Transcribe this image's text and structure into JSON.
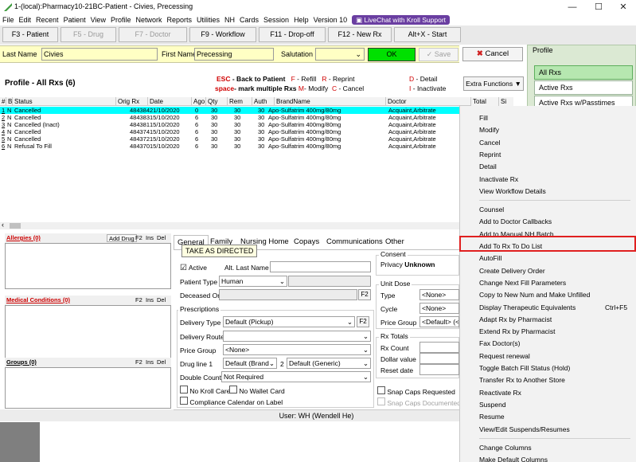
{
  "window": {
    "title": "1-(local):Pharmacy10-21BC-Patient - Civies, Precessing",
    "min": "—",
    "max": "☐",
    "close": "✕"
  },
  "menu": [
    "File",
    "Edit",
    "Recent",
    "Patient",
    "View",
    "Profile",
    "Network",
    "Reports",
    "Utilities",
    "NH",
    "Cards",
    "Session",
    "Help",
    "Version 10"
  ],
  "livechat": "LiveChat with Kroll Support",
  "toolbar": [
    {
      "label": "F3 - Patient",
      "enabled": true
    },
    {
      "label": "F5 - Drug",
      "enabled": false
    },
    {
      "label": "F7 - Doctor",
      "enabled": false
    },
    {
      "label": "F9 - Workflow",
      "enabled": true
    },
    {
      "label": "F11 - Drop-off",
      "enabled": true
    },
    {
      "label": "F12 - New Rx",
      "enabled": true
    },
    {
      "label": "Alt+X - Start",
      "enabled": true
    }
  ],
  "patient": {
    "last_name_label": "Last Name",
    "last_name": "Civies",
    "first_name_label": "First Name",
    "first_name": "Precessing",
    "salutation_label": "Salutation",
    "salutation": "",
    "ok": "OK",
    "save": "Save",
    "cancel": "Cancel"
  },
  "profile_panel": {
    "title": "Profile",
    "items": [
      "All Rxs",
      "Active Rxs",
      "Active Rxs w/Passtimes"
    ]
  },
  "profile": {
    "title": "Profile - All Rxs (6)",
    "esc_key": "ESC",
    "esc_text": "- Back to Patient",
    "f_key": "F",
    "f_text": "- Refill",
    "r_key": "R",
    "r_text": "- Reprint",
    "d_key": "D",
    "d_text": "- Detail",
    "space_key": "space",
    "space_text": "- mark multiple Rxs",
    "m_key": "M",
    "m_text": "- Modify",
    "c_key": "C",
    "c_text": "- Cancel",
    "i_key": "I",
    "i_text": "- Inactivate",
    "extra_functions": "Extra Functions ▼"
  },
  "grid": {
    "columns": [
      "#",
      "B",
      "Status",
      "Orig Rx",
      "Date",
      "Ago",
      "Qty",
      "Rem",
      "Auth",
      "BrandName",
      "Doctor",
      "Total",
      "Si"
    ],
    "rows": [
      {
        "n": "1",
        "b": "N",
        "status": "Cancelled",
        "orig": "484384",
        "date": "21/10/2020",
        "ago": "0",
        "qty": "30",
        "rem": "30",
        "auth": "30",
        "brand": "Apo-Sulfatrim 400mg/80mg",
        "doctor": "Acquaint,Arbitrate"
      },
      {
        "n": "2",
        "b": "N",
        "status": "Cancelled",
        "orig": "484383",
        "date": "15/10/2020",
        "ago": "6",
        "qty": "30",
        "rem": "30",
        "auth": "30",
        "brand": "Apo-Sulfatrim 400mg/80mg",
        "doctor": "Acquaint,Arbitrate"
      },
      {
        "n": "3",
        "b": "N",
        "status": "Cancelled (Inact)",
        "orig": "484381",
        "date": "15/10/2020",
        "ago": "6",
        "qty": "30",
        "rem": "30",
        "auth": "30",
        "brand": "Apo-Sulfatrim 400mg/80mg",
        "doctor": "Acquaint,Arbitrate"
      },
      {
        "n": "4",
        "b": "N",
        "status": "Cancelled",
        "orig": "484374",
        "date": "15/10/2020",
        "ago": "6",
        "qty": "30",
        "rem": "30",
        "auth": "30",
        "brand": "Apo-Sulfatrim 400mg/80mg",
        "doctor": "Acquaint,Arbitrate"
      },
      {
        "n": "5",
        "b": "N",
        "status": "Cancelled",
        "orig": "484372",
        "date": "15/10/2020",
        "ago": "6",
        "qty": "30",
        "rem": "30",
        "auth": "30",
        "brand": "Apo-Sulfatrim 400mg/80mg",
        "doctor": "Acquaint,Arbitrate"
      },
      {
        "n": "6",
        "b": "N",
        "status": "Refusal To Fill",
        "orig": "484370",
        "date": "15/10/2020",
        "ago": "6",
        "qty": "30",
        "rem": "30",
        "auth": "30",
        "brand": "Apo-Sulfatrim 400mg/80mg",
        "doctor": "Acquaint,Arbitrate"
      }
    ]
  },
  "left_panels": {
    "allergies": "Allergies (0)",
    "add_drug": "Add Drug",
    "f2": "F2",
    "ins": "Ins",
    "del": "Del",
    "medical": "Medical Conditions (0)",
    "groups": "Groups (0)"
  },
  "tabs": [
    "General",
    "Family",
    "Nursing Home",
    "Copays",
    "Communications",
    "Other"
  ],
  "tooltip": "TAKE AS DIRECTED",
  "general": {
    "active": "Active",
    "alt_last_name": "Alt. Last Name",
    "patient_type_label": "Patient Type",
    "patient_type": "Human",
    "deceased_on": "Deceased On",
    "f2": "F2",
    "prescriptions": "Prescriptions",
    "delivery_type_label": "Delivery Type",
    "delivery_type": "Default (Pickup)",
    "delivery_route_label": "Delivery Route",
    "price_group_label": "Price Group",
    "price_group": "<None>",
    "drug_line_label": "Drug line 1",
    "drug_line_1": "Default (Brand",
    "drug_line_2_label": "2",
    "drug_line_2": "Default (Generic)",
    "double_count_label": "Double Count",
    "double_count": "Not Required",
    "no_kroll_care": "No Kroll Care",
    "no_wallet_card": "No Wallet Card",
    "compliance_calendar": "Compliance Calendar on Label",
    "consent": "Consent",
    "privacy": "Privacy",
    "privacy_value": "Unknown",
    "unit_dose": "Unit Dose",
    "type_label": "Type",
    "type_value": "<None>",
    "cycle_label": "Cycle",
    "cycle_value": "<None>",
    "price_group2_label": "Price Group",
    "price_group2_value": "<Default> (<I",
    "rx_totals": "Rx Totals",
    "rx_count": "Rx Count",
    "dollar_value": "Dollar value",
    "reset_date": "Reset date",
    "snap_caps_requested": "Snap Caps Requested",
    "snap_caps_documented": "Snap Caps Documented"
  },
  "status_user": "User: WH (Wendell He)",
  "context_menu": {
    "groups": [
      [
        "Fill",
        "Modify",
        "Cancel",
        "Reprint",
        "Detail",
        "Inactivate Rx",
        "View Workflow Details"
      ],
      [
        "Counsel",
        "Add to Doctor Callbacks",
        "Add to Manual NH Batch",
        "Add To Rx To Do List",
        "AutoFill",
        "Create Delivery Order",
        "Change Next Fill Parameters",
        "Copy to New Num and Make Unfilled",
        "Display Therapeutic Equivalents",
        "Adapt Rx by Pharmacist",
        "Extend Rx by Pharmacist",
        "Fax Doctor(s)",
        "Request renewal",
        "Toggle Batch Fill Status (Hold)",
        "Transfer Rx to Another Store",
        "Reactivate Rx",
        "Suspend",
        "Resume",
        "View/Edit Suspends/Resumes"
      ],
      [
        "Change Columns",
        "Make Default Columns"
      ]
    ],
    "shortcut_item": "Display Therapeutic Equivalents",
    "shortcut": "Ctrl+F5",
    "highlighted": "Add To Rx To Do List"
  }
}
